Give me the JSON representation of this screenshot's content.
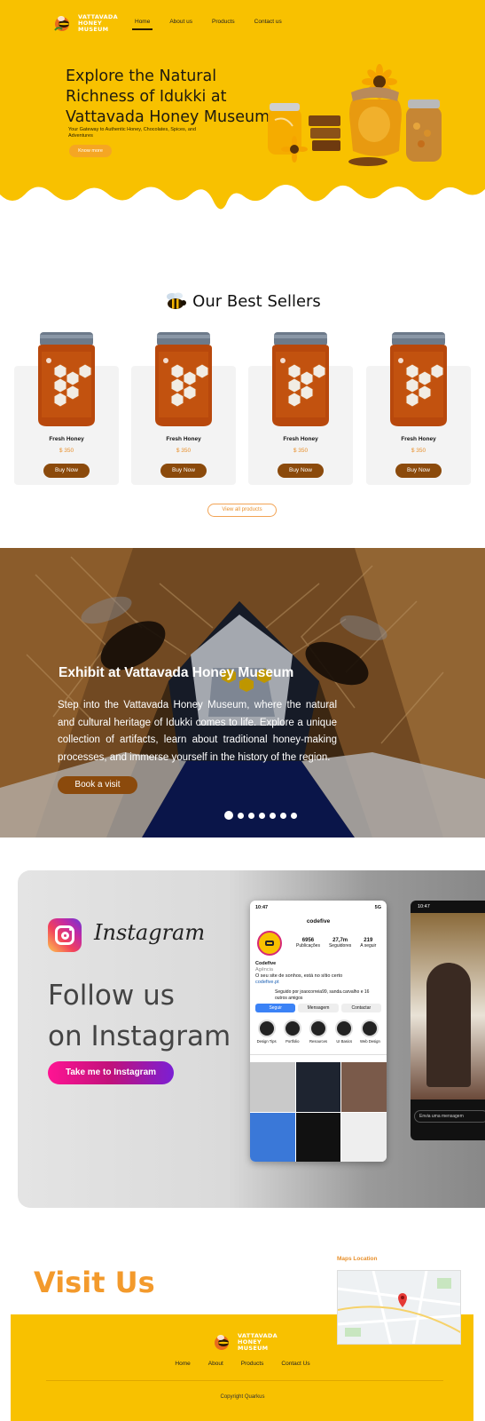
{
  "brand": {
    "logo_text": [
      "VATTAVADA",
      "HONEY",
      "MUSEUM"
    ]
  },
  "nav": {
    "items": [
      "Home",
      "About us",
      "Products",
      "Contact us"
    ],
    "active": "Home"
  },
  "hero": {
    "title": "Explore the Natural Richness of Idukki at Vattavada Honey Museum",
    "subtitle": "Your Gateway to Authentic Honey, Chocolates, Spices, and Adventures",
    "button": "Know more"
  },
  "sellers": {
    "title": "Our Best Sellers",
    "products": [
      {
        "name": "Fresh Honey",
        "price": "$ 350",
        "button": "Buy Now"
      },
      {
        "name": "Fresh Honey",
        "price": "$ 350",
        "button": "Buy Now"
      },
      {
        "name": "Fresh Honey",
        "price": "$ 350",
        "button": "Buy Now"
      },
      {
        "name": "Fresh Honey",
        "price": "$ 350",
        "button": "Buy Now"
      }
    ],
    "view_all": "View all products"
  },
  "exhibit": {
    "title": "Exhibit at Vattavada Honey Museum",
    "text": "Step into the Vattavada Honey Museum, where the natural and cultural heritage of Idukki comes to life. Explore a unique collection of artifacts, learn about traditional honey-making processes, and immerse yourself in the history of the region.",
    "button": "Book  a visit",
    "slides": 7,
    "active_slide": 1
  },
  "instagram": {
    "word": "Instagram",
    "heading_line1": "Follow us",
    "heading_line2": "on Instagram",
    "button": "Take me to Instagram",
    "phone": {
      "time": "10:47",
      "signal": "5G",
      "username": "codefive",
      "stats": [
        {
          "value": "6956",
          "label": "Publicações"
        },
        {
          "value": "27,7m",
          "label": "Seguidores"
        },
        {
          "value": "219",
          "label": "A seguir"
        }
      ],
      "name": "Codefive",
      "category": "Agência",
      "bio": "O seu site de sonhos, está no sítio certo",
      "link": "codefive.pt",
      "followed_by": "Seguido por joaocorreia99, sanda.carvalho e 16 outros amigos",
      "actions": [
        "Seguir",
        "Mensagem",
        "Contactar"
      ],
      "highlights": [
        "Design Tips",
        "Portfolio",
        "Resources",
        "UI Basics",
        "Web Design"
      ]
    },
    "phone2": {
      "time": "10:47",
      "input": "Envia uma mensagem"
    }
  },
  "visit": {
    "title": "Visit Us",
    "maps_label": "Maps Location"
  },
  "footer": {
    "nav": [
      "Home",
      "About",
      "Products",
      "Contact Us"
    ],
    "copyright": "Copyright Quarkus"
  },
  "colors": {
    "honey": "#f8c100",
    "brown": "#8b4a0c",
    "orange": "#f39a2c"
  }
}
